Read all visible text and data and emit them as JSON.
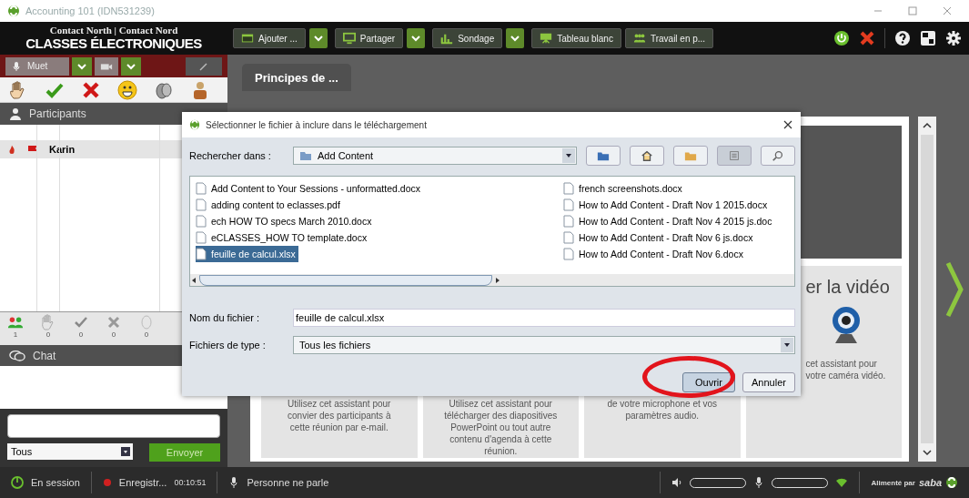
{
  "window": {
    "title": "Accounting 101 (IDN531239)"
  },
  "brand": {
    "line_1": "Contact North | Contact Nord",
    "line_2": "CLASSES ÉLECTRONIQUES"
  },
  "toolbar": [
    {
      "label": "Ajouter ...",
      "kind": "add",
      "dropdown": true
    },
    {
      "label": "Partager",
      "kind": "share",
      "dropdown": true
    },
    {
      "label": "Sondage",
      "kind": "poll",
      "dropdown": true
    },
    {
      "label": "Tableau blanc",
      "kind": "board",
      "dropdown": false
    },
    {
      "label": "Travail en p...",
      "kind": "group",
      "dropdown": false
    }
  ],
  "audio": {
    "mute_label": "Muet"
  },
  "participants": {
    "title": "Participants",
    "rows": [
      {
        "name": "Karin",
        "selected": true
      }
    ]
  },
  "counts": [
    "1",
    "0",
    "0",
    "0",
    "0"
  ],
  "chat": {
    "title": "Chat",
    "recipient": "Tous",
    "send_label": "Envoyer"
  },
  "tabs": [
    {
      "label": "Principes de ...",
      "selected": true
    }
  ],
  "cards": [
    {
      "kind": "plain",
      "lines": [
        "Utilisez cet assistant pour",
        "convier des participants à",
        "cette réunion par e-mail."
      ]
    },
    {
      "kind": "plain",
      "lines": [
        "Utilisez cet assistant pour",
        "télécharger des diapositives",
        "PowerPoint ou tout autre",
        "contenu d'agenda à cette",
        "réunion."
      ]
    },
    {
      "kind": "plain",
      "lines": [
        "de votre microphone et vos",
        "paramètres audio."
      ]
    },
    {
      "kind": "video",
      "heading": "er la vidéo",
      "lines": [
        "cet assistant pour",
        "votre caméra vidéo."
      ]
    }
  ],
  "dialog": {
    "title": "Sélectionner le fichier à inclure dans le téléchargement",
    "look_in_label": "Rechercher dans :",
    "look_in_value": "Add Content",
    "files": [
      {
        "name": "Add Content to Your Sessions - unformatted.docx",
        "selected": false
      },
      {
        "name": "adding content to eclasses.pdf",
        "selected": false
      },
      {
        "name": "ech HOW TO specs March 2010.docx",
        "selected": false
      },
      {
        "name": "eCLASSES_HOW TO template.docx",
        "selected": false
      },
      {
        "name": "feuille de calcul.xlsx",
        "selected": true
      },
      {
        "name": "french screenshots.docx",
        "selected": false
      },
      {
        "name": "How to Add Content - Draft Nov 1 2015.docx",
        "selected": false
      },
      {
        "name": "How to Add Content - Draft Nov 4 2015 js.doc",
        "selected": false
      },
      {
        "name": "How to Add Content - Draft Nov 6  js.docx",
        "selected": false
      },
      {
        "name": "How to Add Content - Draft Nov 6.docx",
        "selected": false
      }
    ],
    "filename_label": "Nom du fichier :",
    "filename_value": "feuille de calcul.xlsx",
    "filetype_label": "Fichiers de type :",
    "filetype_value": "Tous les fichiers",
    "open_label": "Ouvrir",
    "cancel_label": "Annuler"
  },
  "status_bar": {
    "session": "En session",
    "recording": "Enregistr...",
    "time": "00:10:51",
    "speaking": "Personne ne parle",
    "powered_by": "Alimenté par",
    "brand": "saba"
  }
}
